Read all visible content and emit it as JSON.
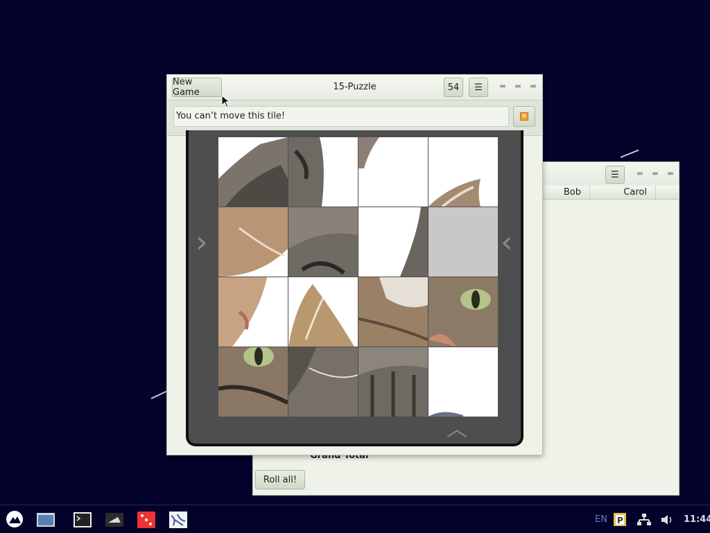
{
  "puzzle_window": {
    "title": "15-Puzzle",
    "new_game_label": "New Game",
    "moves_count": "54",
    "menu_icon": "hamburger-icon",
    "info_message": "You can’t move this tile!",
    "close_info_icon": "close-icon"
  },
  "dice_window": {
    "columns": [
      "Bob",
      "Carol"
    ],
    "grand_total_label": "Grand Total",
    "roll_all_label": "Roll all!"
  },
  "board": {
    "empty_tile_index": 7,
    "tile_count": 16
  },
  "taskbar": {
    "apps": [
      "app-menu-icon",
      "file-manager-icon",
      "terminal-icon",
      "notes-icon",
      "dice-game-icon",
      "puzzle-game-icon"
    ],
    "keyboard_layout": "EN",
    "clock": "11:44"
  },
  "colors": {
    "desktop_bg": "#02022a",
    "window_bg": "#eef2e9",
    "board_bg": "#4e4e4e"
  }
}
